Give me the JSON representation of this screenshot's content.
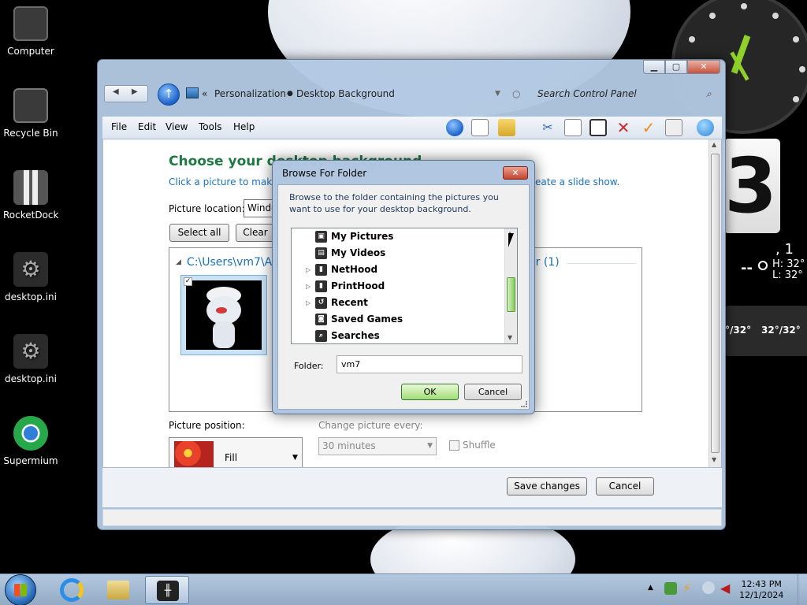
{
  "desktop": {
    "icons": [
      {
        "label": "Computer",
        "icon": "computer-icon"
      },
      {
        "label": "Recycle Bin",
        "icon": "recycle-bin-icon"
      },
      {
        "label": "RocketDock",
        "icon": "rocketdock-icon"
      },
      {
        "label": "desktop.ini",
        "icon": "settings-file-icon"
      },
      {
        "label": "desktop.ini",
        "icon": "settings-file-icon"
      },
      {
        "label": "Supermium",
        "icon": "supermium-browser-icon"
      }
    ],
    "flip_clock_digit": "3",
    "weather": {
      "temp_suffix": ", 1",
      "current": "--",
      "high": "H: 32°",
      "low": "L: 32°",
      "forecast_left": "°/32°",
      "forecast_right": "32°/32°"
    }
  },
  "window": {
    "breadcrumb": {
      "separator": "«",
      "items": [
        "Personalization",
        "Desktop Background"
      ]
    },
    "search_placeholder": "Search Control Panel",
    "menu": [
      "File",
      "Edit",
      "View",
      "Tools",
      "Help"
    ],
    "content": {
      "title": "Choose your desktop background",
      "subtitle_left": "Click a picture to make it",
      "subtitle_right": "eate a slide show.",
      "picture_location_label": "Picture location:",
      "picture_location_value": "Windo",
      "select_all": "Select all",
      "clear_all": "Clear",
      "path": "C:\\Users\\vm7\\Ap",
      "path_count": "er (1)",
      "picture_position_label": "Picture position:",
      "picture_position_value": "Fill",
      "change_every_label": "Change picture every:",
      "change_every_value": "30 minutes",
      "shuffle_label": "Shuffle"
    },
    "save_changes": "Save changes",
    "cancel": "Cancel"
  },
  "dialog": {
    "title": "Browse For Folder",
    "close_glyph": "✕",
    "instruction": "Browse to the folder containing the pictures you want to use for your desktop background.",
    "tree": [
      {
        "label": "My Pictures",
        "expandable": false,
        "icon": "pictures-folder-icon"
      },
      {
        "label": "My Videos",
        "expandable": false,
        "icon": "videos-folder-icon"
      },
      {
        "label": "NetHood",
        "expandable": true,
        "icon": "folder-icon"
      },
      {
        "label": "PrintHood",
        "expandable": true,
        "icon": "folder-icon"
      },
      {
        "label": "Recent",
        "expandable": true,
        "icon": "recent-icon"
      },
      {
        "label": "Saved Games",
        "expandable": false,
        "icon": "saved-games-icon"
      },
      {
        "label": "Searches",
        "expandable": false,
        "icon": "searches-icon"
      }
    ],
    "folder_label": "Folder:",
    "folder_value": "vm7",
    "ok": "OK",
    "cancel": "Cancel"
  },
  "taskbar": {
    "time": "12:43 PM",
    "date": "12/1/2024"
  }
}
